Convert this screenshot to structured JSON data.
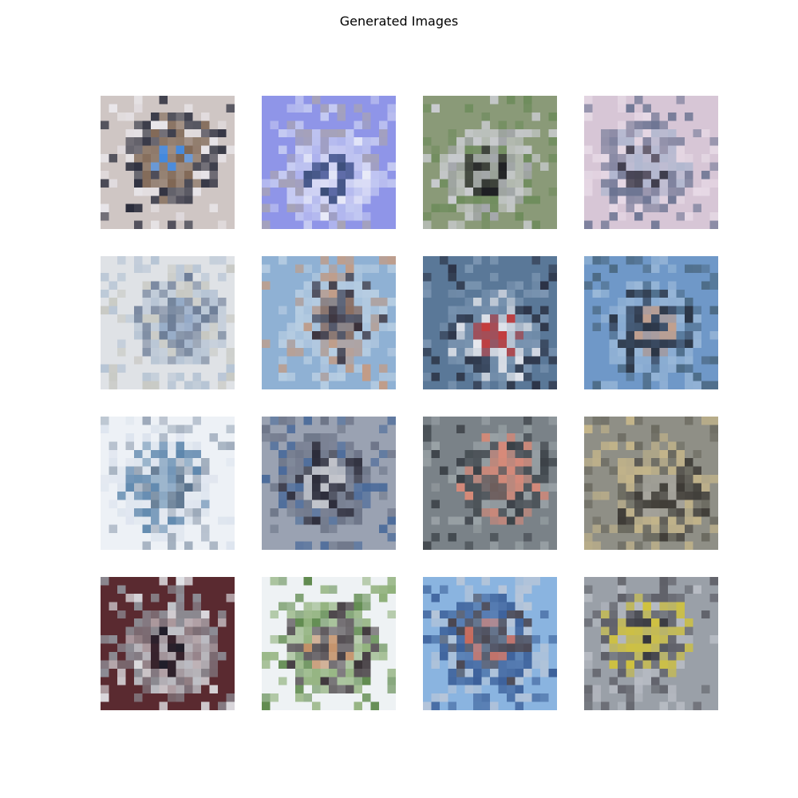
{
  "figure": {
    "title": "Generated Images",
    "grid": {
      "rows": 4,
      "columns": 4
    }
  },
  "images": [
    {
      "subject": "blurry bird with blue body on dark background",
      "palette": [
        "#cfc6c4",
        "#2b2d3c",
        "#7e6552",
        "#2f7fe0",
        "#e9e6ea"
      ]
    },
    {
      "subject": "boxy object on pale blue background",
      "palette": [
        "#8f95e8",
        "#c6cbf2",
        "#e8eaf8",
        "#3c4f7a",
        "#a7a3b6"
      ]
    },
    {
      "subject": "grey animal face with dark nose on green",
      "palette": [
        "#8a9a78",
        "#c9cbcf",
        "#a5a8ad",
        "#1b1b20",
        "#6e8c5c"
      ]
    },
    {
      "subject": "grey car in front of pink wall",
      "palette": [
        "#d7c6d6",
        "#6c7492",
        "#b0b7cf",
        "#2a2a3a",
        "#e7dae6"
      ]
    },
    {
      "subject": "white fluffy dog with blue patches",
      "palette": [
        "#dfe2e6",
        "#b6c4d4",
        "#6b7c96",
        "#8ea5c4",
        "#c7c8c2"
      ]
    },
    {
      "subject": "dark animal silhouette against sky",
      "palette": [
        "#8fb1d4",
        "#b7cde2",
        "#3a3038",
        "#8a6c5e",
        "#c29c86"
      ]
    },
    {
      "subject": "white boat with red stripe on water",
      "palette": [
        "#5a7898",
        "#7c96b2",
        "#e6e8ee",
        "#c33d3d",
        "#2b3244"
      ]
    },
    {
      "subject": "ship on blue water",
      "palette": [
        "#6f98c8",
        "#9ab8d8",
        "#2c3646",
        "#c7a08a",
        "#4d6b86"
      ]
    },
    {
      "subject": "blue airplane on white sky",
      "palette": [
        "#edf1f6",
        "#dde4ee",
        "#5e87ad",
        "#3d5a78",
        "#9aa7b8"
      ]
    },
    {
      "subject": "truck with dark cab",
      "palette": [
        "#9aa2b2",
        "#6d7588",
        "#2a2a38",
        "#c5c7cd",
        "#4a6a9a"
      ]
    },
    {
      "subject": "reddish landscape with dark foreground",
      "palette": [
        "#7a8288",
        "#3a4046",
        "#d98a78",
        "#6d5a58",
        "#9aa2a6"
      ]
    },
    {
      "subject": "frog-like tan and dark texture",
      "palette": [
        "#8f8f86",
        "#c4b58a",
        "#3e3b36",
        "#a7a59d",
        "#6b6a60"
      ]
    },
    {
      "subject": "grey round object on dark red background",
      "palette": [
        "#5a2a30",
        "#8f9098",
        "#c0c2c8",
        "#1e1e2a",
        "#e8ecf0"
      ]
    },
    {
      "subject": "deer on green field",
      "palette": [
        "#eef2f4",
        "#8fb07a",
        "#3b3438",
        "#c08a5e",
        "#5f8a4e"
      ]
    },
    {
      "subject": "blue truck under sky",
      "palette": [
        "#8ab4e0",
        "#3a5e98",
        "#4a4650",
        "#c86a5a",
        "#b8c6d8"
      ]
    },
    {
      "subject": "truck with yellow stripe",
      "palette": [
        "#9aa0a8",
        "#5f6068",
        "#d0c23e",
        "#2e2e34",
        "#b8bcc4"
      ]
    }
  ]
}
